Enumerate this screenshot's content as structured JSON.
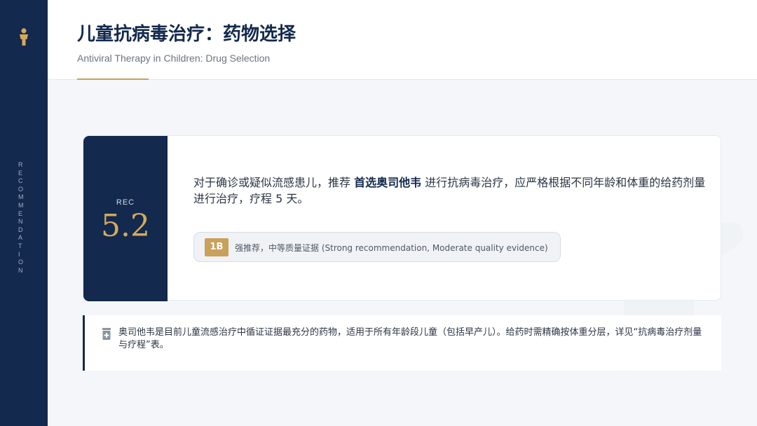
{
  "sidebar": {
    "icon": "person-icon",
    "vertical_text": "R\nE\nC\nO\nM\nM\nE\nN\nD\nA\nT\nI\nO\nN"
  },
  "header": {
    "title": "儿童抗病毒治疗：药物选择",
    "subtitle": "Antiviral Therapy in Children: Drug Selection"
  },
  "recommendation": {
    "label": "REC",
    "number": "5.2",
    "text_before": "对于确诊或疑似流感患儿，推荐 ",
    "drug": "首选奥司他韦",
    "text_after": " 进行抗病毒治疗，应严格根据不同年龄和体重的给药剂量进行治疗，疗程 5 天。",
    "grade": "1B",
    "grade_text": "强推荐，中等质量证据 (Strong recommendation, Moderate quality evidence)"
  },
  "note": {
    "icon": "medicine-bottle-icon",
    "text": "奥司他韦是目前儿童流感治疗中循证证据最充分的药物，适用于所有年龄段儿童（包括早产儿）。给药时需精确按体重分层，详见“抗病毒治疗剂量与疗程”表。"
  },
  "colors": {
    "navy": "#13294d",
    "gold": "#c9a15a",
    "background": "#f4f6f9"
  }
}
